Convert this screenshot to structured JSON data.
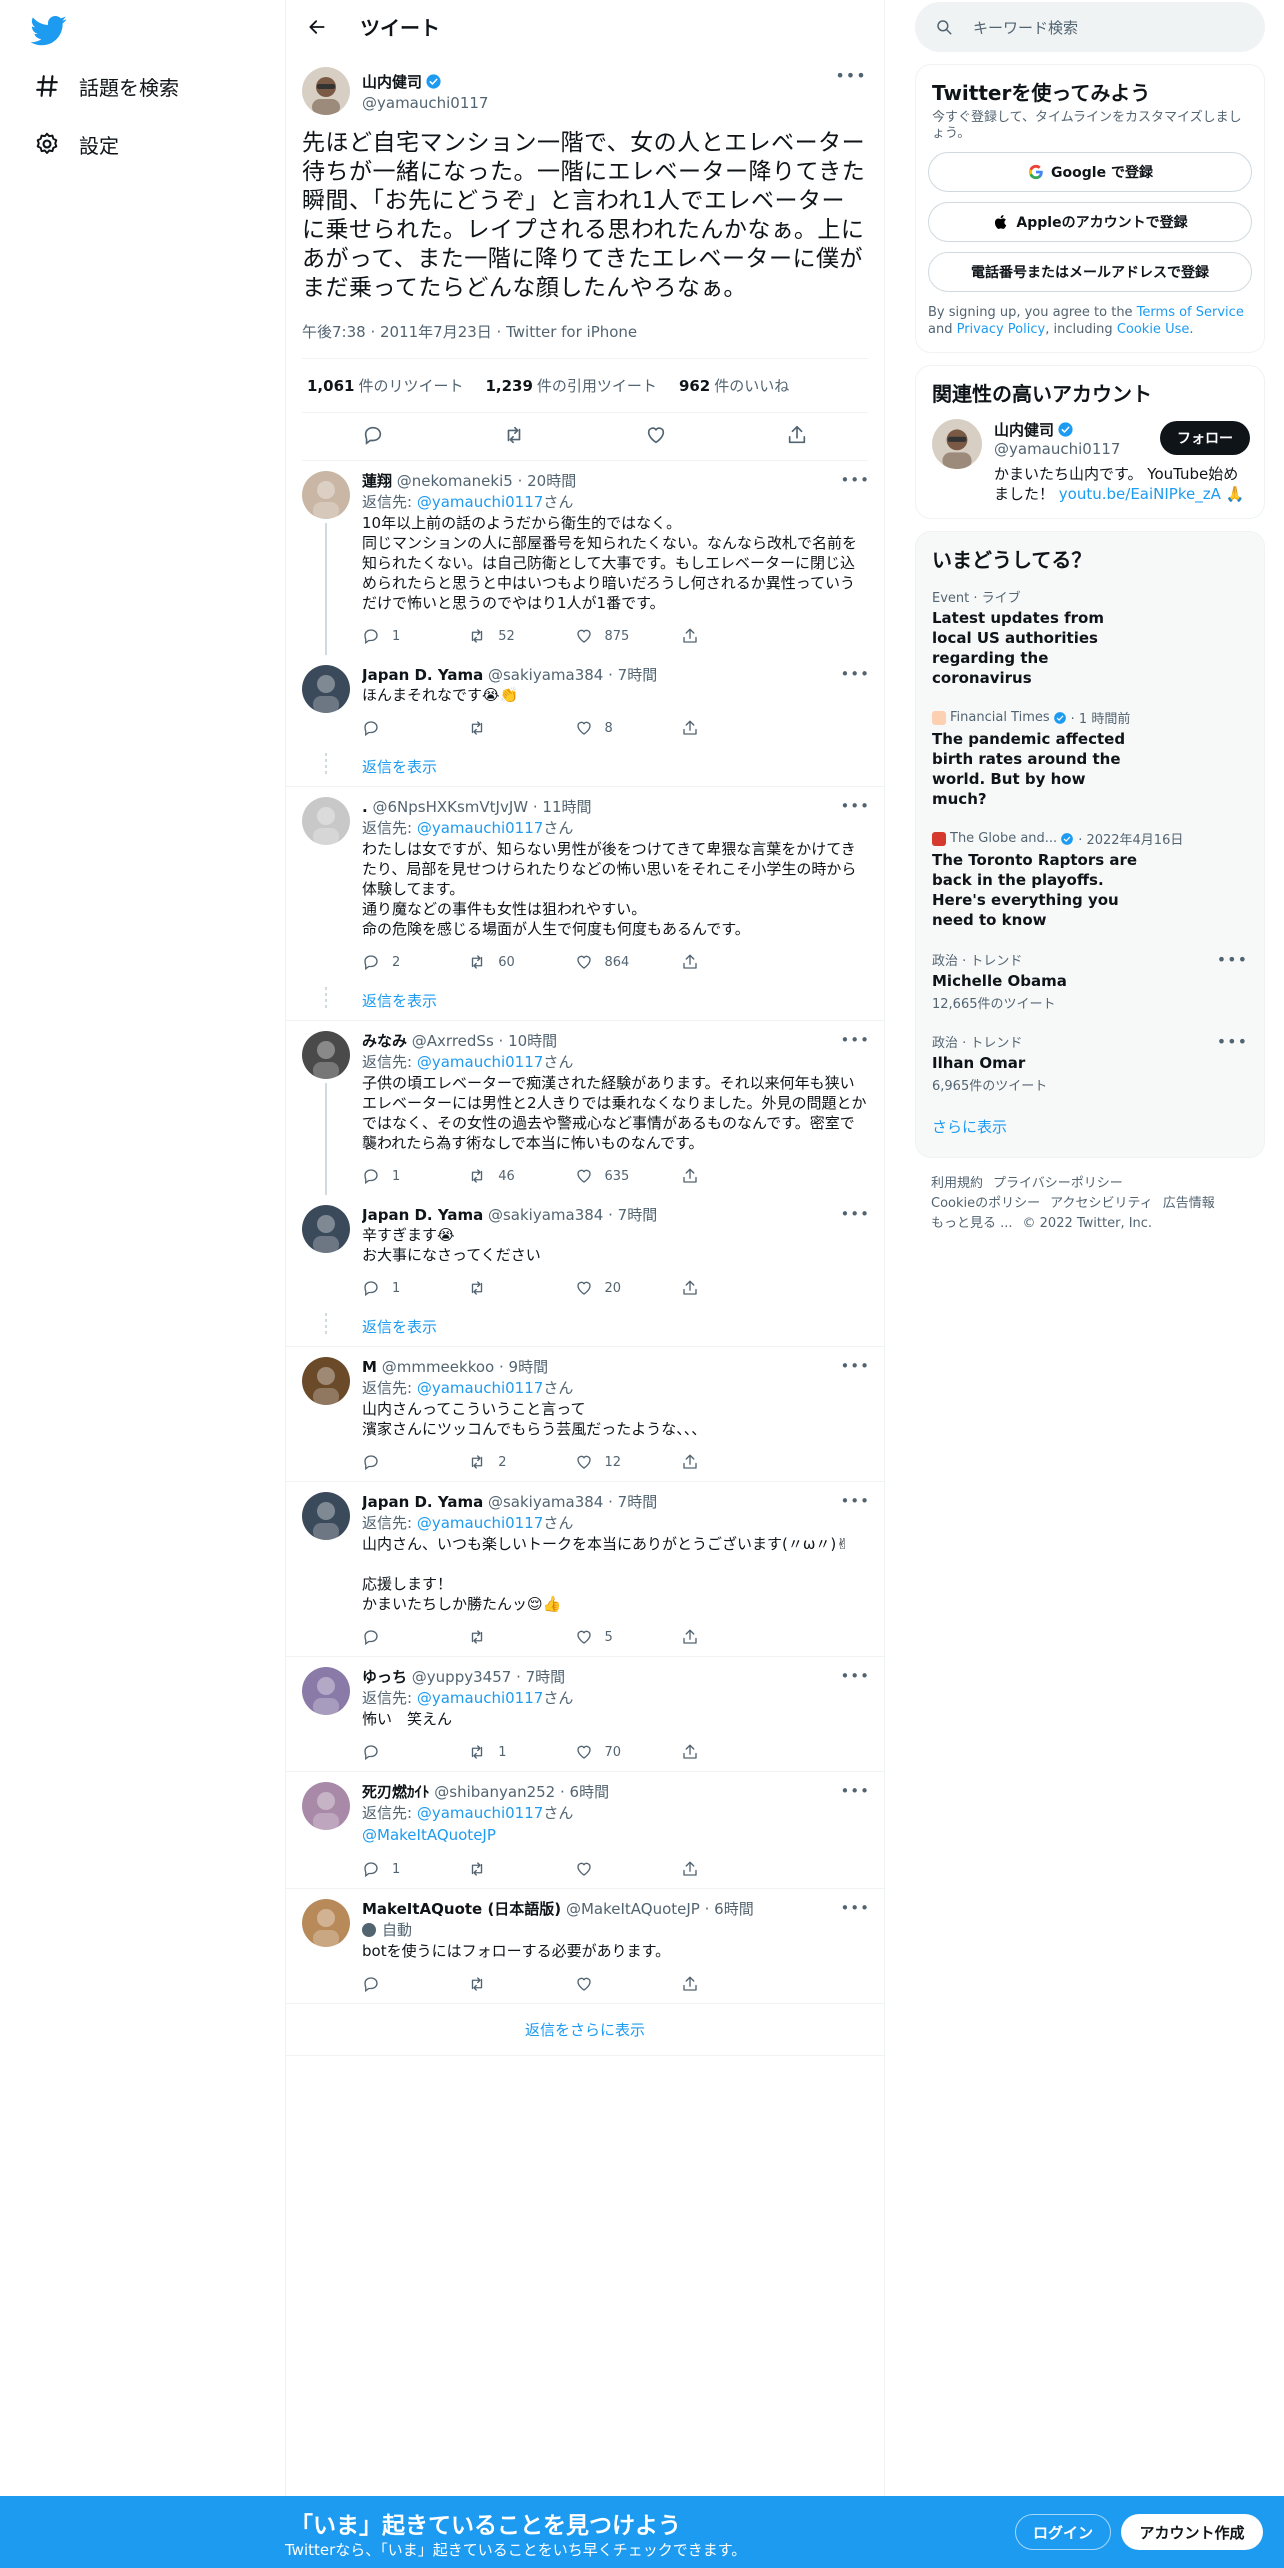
{
  "nav": {
    "explore": "話題を検索",
    "settings": "設定"
  },
  "header": {
    "title": "ツイート"
  },
  "main_tweet": {
    "name": "山内健司",
    "handle": "@yamauchi0117",
    "text": "先ほど自宅マンション一階で、女の人とエレベーター待ちが一緒になった。一階にエレベーター降りてきた瞬間、「お先にどうぞ」と言われ1人でエレベーターに乗せられた。レイプされる思われたんかなぁ。上にあがって、また一階に降りてきたエレベーターに僕がまだ乗ってたらどんな顔したんやろなぁ。",
    "meta": "午後7:38 · 2011年7月23日 · Twitter for iPhone",
    "retweets": "1,061",
    "retweets_label": "件のリツイート",
    "quotes": "1,239",
    "quotes_label": "件の引用ツイート",
    "likes": "962",
    "likes_label": "件のいいね"
  },
  "replies": [
    {
      "name": "蓮翔",
      "handle": "@nekomaneki5",
      "time": "· 20時間",
      "replyto_prefix": "返信先: ",
      "replyto": "@yamauchi0117",
      "replyto_suffix": "さん",
      "text": "10年以上前の話のようだから衛生的ではなく。\n同じマンションの人に部屋番号を知られたくない。なんなら改札で名前を知られたくない。は自己防衛として大事です。もしエレベーターに閉じ込められたらと思うと中はいつもより暗いだろうし何されるか異性っていうだけで怖いと思うのでやはり1人が1番です。",
      "replies": "1",
      "retweets": "52",
      "likes": "875"
    },
    {
      "name": "Japan D. Yama",
      "handle": "@sakiyama384",
      "time": "· 7時間",
      "text": "ほんまそれなです😭👏",
      "replies": "",
      "retweets": "",
      "likes": "8"
    },
    {
      "name": ".",
      "handle": "@6NpsHXKsmVtJvJW",
      "time": "· 11時間",
      "replyto_prefix": "返信先: ",
      "replyto": "@yamauchi0117",
      "replyto_suffix": "さん",
      "text": "わたしは女ですが、知らない男性が後をつけてきて卑猥な言葉をかけてきたり、局部を見せつけられたりなどの怖い思いをそれこそ小学生の時から体験してます。\n通り魔などの事件も女性は狙われやすい。\n命の危険を感じる場面が人生で何度も何度もあるんです。",
      "replies": "2",
      "retweets": "60",
      "likes": "864"
    },
    {
      "name": "みなみ",
      "handle": "@AxrredSs",
      "time": "· 10時間",
      "replyto_prefix": "返信先: ",
      "replyto": "@yamauchi0117",
      "replyto_suffix": "さん",
      "text": "子供の頃エレベーターで痴漢された経験があります。それ以来何年も狭いエレベーターには男性と2人きりでは乗れなくなりました。外見の問題とかではなく、その女性の過去や警戒心など事情があるものなんです。密室で襲われたら為す術なしで本当に怖いものなんです。",
      "replies": "1",
      "retweets": "46",
      "likes": "635"
    },
    {
      "name": "Japan D. Yama",
      "handle": "@sakiyama384",
      "time": "· 7時間",
      "text": "辛すぎます😭\nお大事になさってください",
      "replies": "1",
      "retweets": "",
      "likes": "20"
    },
    {
      "name": "M",
      "handle": "@mmmeekkoo",
      "time": "· 9時間",
      "replyto_prefix": "返信先: ",
      "replyto": "@yamauchi0117",
      "replyto_suffix": "さん",
      "text": "山内さんってこういうこと言って\n濱家さんにツッコんでもらう芸風だったような、、、",
      "replies": "",
      "retweets": "2",
      "likes": "12"
    },
    {
      "name": "Japan D. Yama",
      "handle": "@sakiyama384",
      "time": "· 7時間",
      "replyto_prefix": "返信先: ",
      "replyto": "@yamauchi0117",
      "replyto_suffix": "さん",
      "text": "山内さん、いつも楽しいトークを本当にありがとうございます(〃ω〃)✌\n\n応援します！\nかまいたちしか勝たんッ😌👍",
      "replies": "",
      "retweets": "",
      "likes": "5"
    },
    {
      "name": "ゆっち",
      "handle": "@yuppy3457",
      "time": "· 7時間",
      "replyto_prefix": "返信先: ",
      "replyto": "@yamauchi0117",
      "replyto_suffix": "さん",
      "text": "怖い　笑えん",
      "replies": "",
      "retweets": "1",
      "likes": "70"
    },
    {
      "name": "死刃燃ｶｲﾄ",
      "handle": "@shibanyan252",
      "time": "· 6時間",
      "replyto_prefix": "返信先: ",
      "replyto": "@yamauchi0117",
      "replyto_suffix": "さん",
      "mention": "@MakeItAQuoteJP",
      "replies": "1",
      "retweets": "",
      "likes": ""
    },
    {
      "name": "MakeItAQuote (日本語版)",
      "handle": "@MakeItAQuoteJP",
      "time": "· 6時間",
      "auto": "自動",
      "text": "botを使うにはフォローする必要があります。",
      "replies": "",
      "retweets": "",
      "likes": ""
    }
  ],
  "show_replies": "返信を表示",
  "show_more_replies": "返信をさらに表示",
  "search": {
    "placeholder": "キーワード検索"
  },
  "signup_card": {
    "title": "Twitterを使ってみよう",
    "sub": "今すぐ登録して、タイムラインをカスタマイズしましょう。",
    "google": "Google で登録",
    "apple": "Appleのアカウントで登録",
    "phone": "電話番号またはメールアドレスで登録",
    "terms_a": "By signing up, you agree to the ",
    "terms_tos": "Terms of Service",
    "terms_b": " and ",
    "terms_pp": "Privacy Policy",
    "terms_c": ", including ",
    "terms_cookie": "Cookie Use",
    "terms_d": "."
  },
  "related": {
    "title": "関連性の高いアカウント",
    "name": "山内健司",
    "handle": "@yamauchi0117",
    "follow": "フォロー",
    "bio": "かまいたち山内です。 YouTube始めました！",
    "bio_link": "youtu.be/EaiNIPke_zA",
    "bio_emoji": " 🙏"
  },
  "trends": {
    "title": "いまどうしてる？",
    "items": [
      {
        "meta": "Event · ライブ",
        "title": "Latest updates from local US authorities regarding the coronavirus",
        "news": true
      },
      {
        "source": "Financial Times",
        "time": "· 1 時間前",
        "title": "The pandemic affected birth rates around the world. But by how much?",
        "news": true
      },
      {
        "source": "The Globe and...",
        "time": "· 2022年4月16日",
        "title": "The Toronto Raptors are back in the playoffs. Here's everything you need to know",
        "news": true
      },
      {
        "meta": "政治 · トレンド",
        "title": "Michelle Obama",
        "count": "12,665件のツイート"
      },
      {
        "meta": "政治 · トレンド",
        "title": "Ilhan Omar",
        "count": "6,965件のツイート"
      }
    ],
    "show_more": "さらに表示"
  },
  "footer": {
    "terms": "利用規約",
    "privacy": "プライバシーポリシー",
    "cookie": "Cookieのポリシー",
    "access": "アクセシビリティ",
    "ads": "広告情報",
    "more": "もっと見る ...",
    "copy": "© 2022 Twitter, Inc."
  },
  "bottom": {
    "title": "「いま」起きていることを見つけよう",
    "sub": "Twitterなら、「いま」起きていることをいち早くチェックできます。",
    "login": "ログイン",
    "signup": "アカウント作成"
  },
  "colors": {
    "accent": "#1d9bf0",
    "text": "#0f1419",
    "muted": "#536471"
  }
}
